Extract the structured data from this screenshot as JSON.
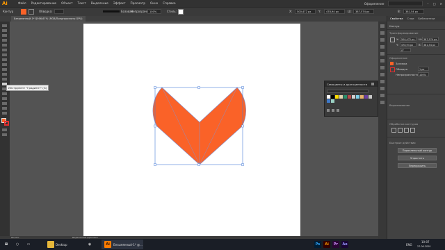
{
  "app": {
    "logo": "Ai",
    "menus": [
      "Файл",
      "Редактирование",
      "Объект",
      "Текст",
      "Выделение",
      "Эффект",
      "Просмотр",
      "Окно",
      "Справка"
    ],
    "workspace": "Оформление",
    "window_controls": [
      "–",
      "□",
      "✕"
    ]
  },
  "control": {
    "mode": "Контур",
    "stroke_label": "Обводка:",
    "brush": "Базовая",
    "opacity_label": "Непрозрачность:",
    "opacity": "100%",
    "style_label": "Стиль:",
    "x": "500,472 px",
    "y": "478,94 px",
    "w": "387,574 px",
    "h": "381,54 px",
    "x_label": "X:",
    "y_label": "Y:",
    "w_label": "Ш:",
    "h_label": "В:"
  },
  "doc_tab": "Безымянный-1* @ 66,67% (RGB/Предпросмотр GPU)",
  "tooltip": "Инструмент \"Градиент\" (G)",
  "swatches_panel": {
    "title": "Самоцветы и драгоценности"
  },
  "right_panel": {
    "tabs": [
      "Свойства",
      "Слои",
      "Библиотеки"
    ],
    "section_contour": "Контур",
    "section_transform": "Трансформирование",
    "x": "500,472 px",
    "y": "478,94 px",
    "w": "387,574 px",
    "h": "381,54 px",
    "x_label": "X:",
    "y_label": "Y:",
    "w_label": "Ш:",
    "h_label": "В:",
    "angle": "0°",
    "section_appearance": "Оформление",
    "fill_label": "Заливка",
    "stroke_label": "Обводка",
    "opacity_label": "Непрозрачность",
    "stroke_value": "1 px",
    "opacity_value": "100%",
    "section_align": "Выравнивание",
    "section_pathfinder": "Обработка контуров",
    "section_quick": "Быстрые действия",
    "btn_offset": "Параллельный контур",
    "btn_simplify": "Упростить",
    "btn_recolor": "Перекрасить"
  },
  "status": {
    "zoom": "66,67%",
    "tool": "Выделенный фрагмент"
  },
  "taskbar": {
    "desktop": "Desktop",
    "active_doc": "Безымянный-1* @...",
    "time": "10:07",
    "date": "27.06.2020",
    "lang": "ENG"
  },
  "colors": {
    "fill": "#fa6228",
    "stroke": "#8a90c8",
    "bbox": "#4a7fd8"
  }
}
